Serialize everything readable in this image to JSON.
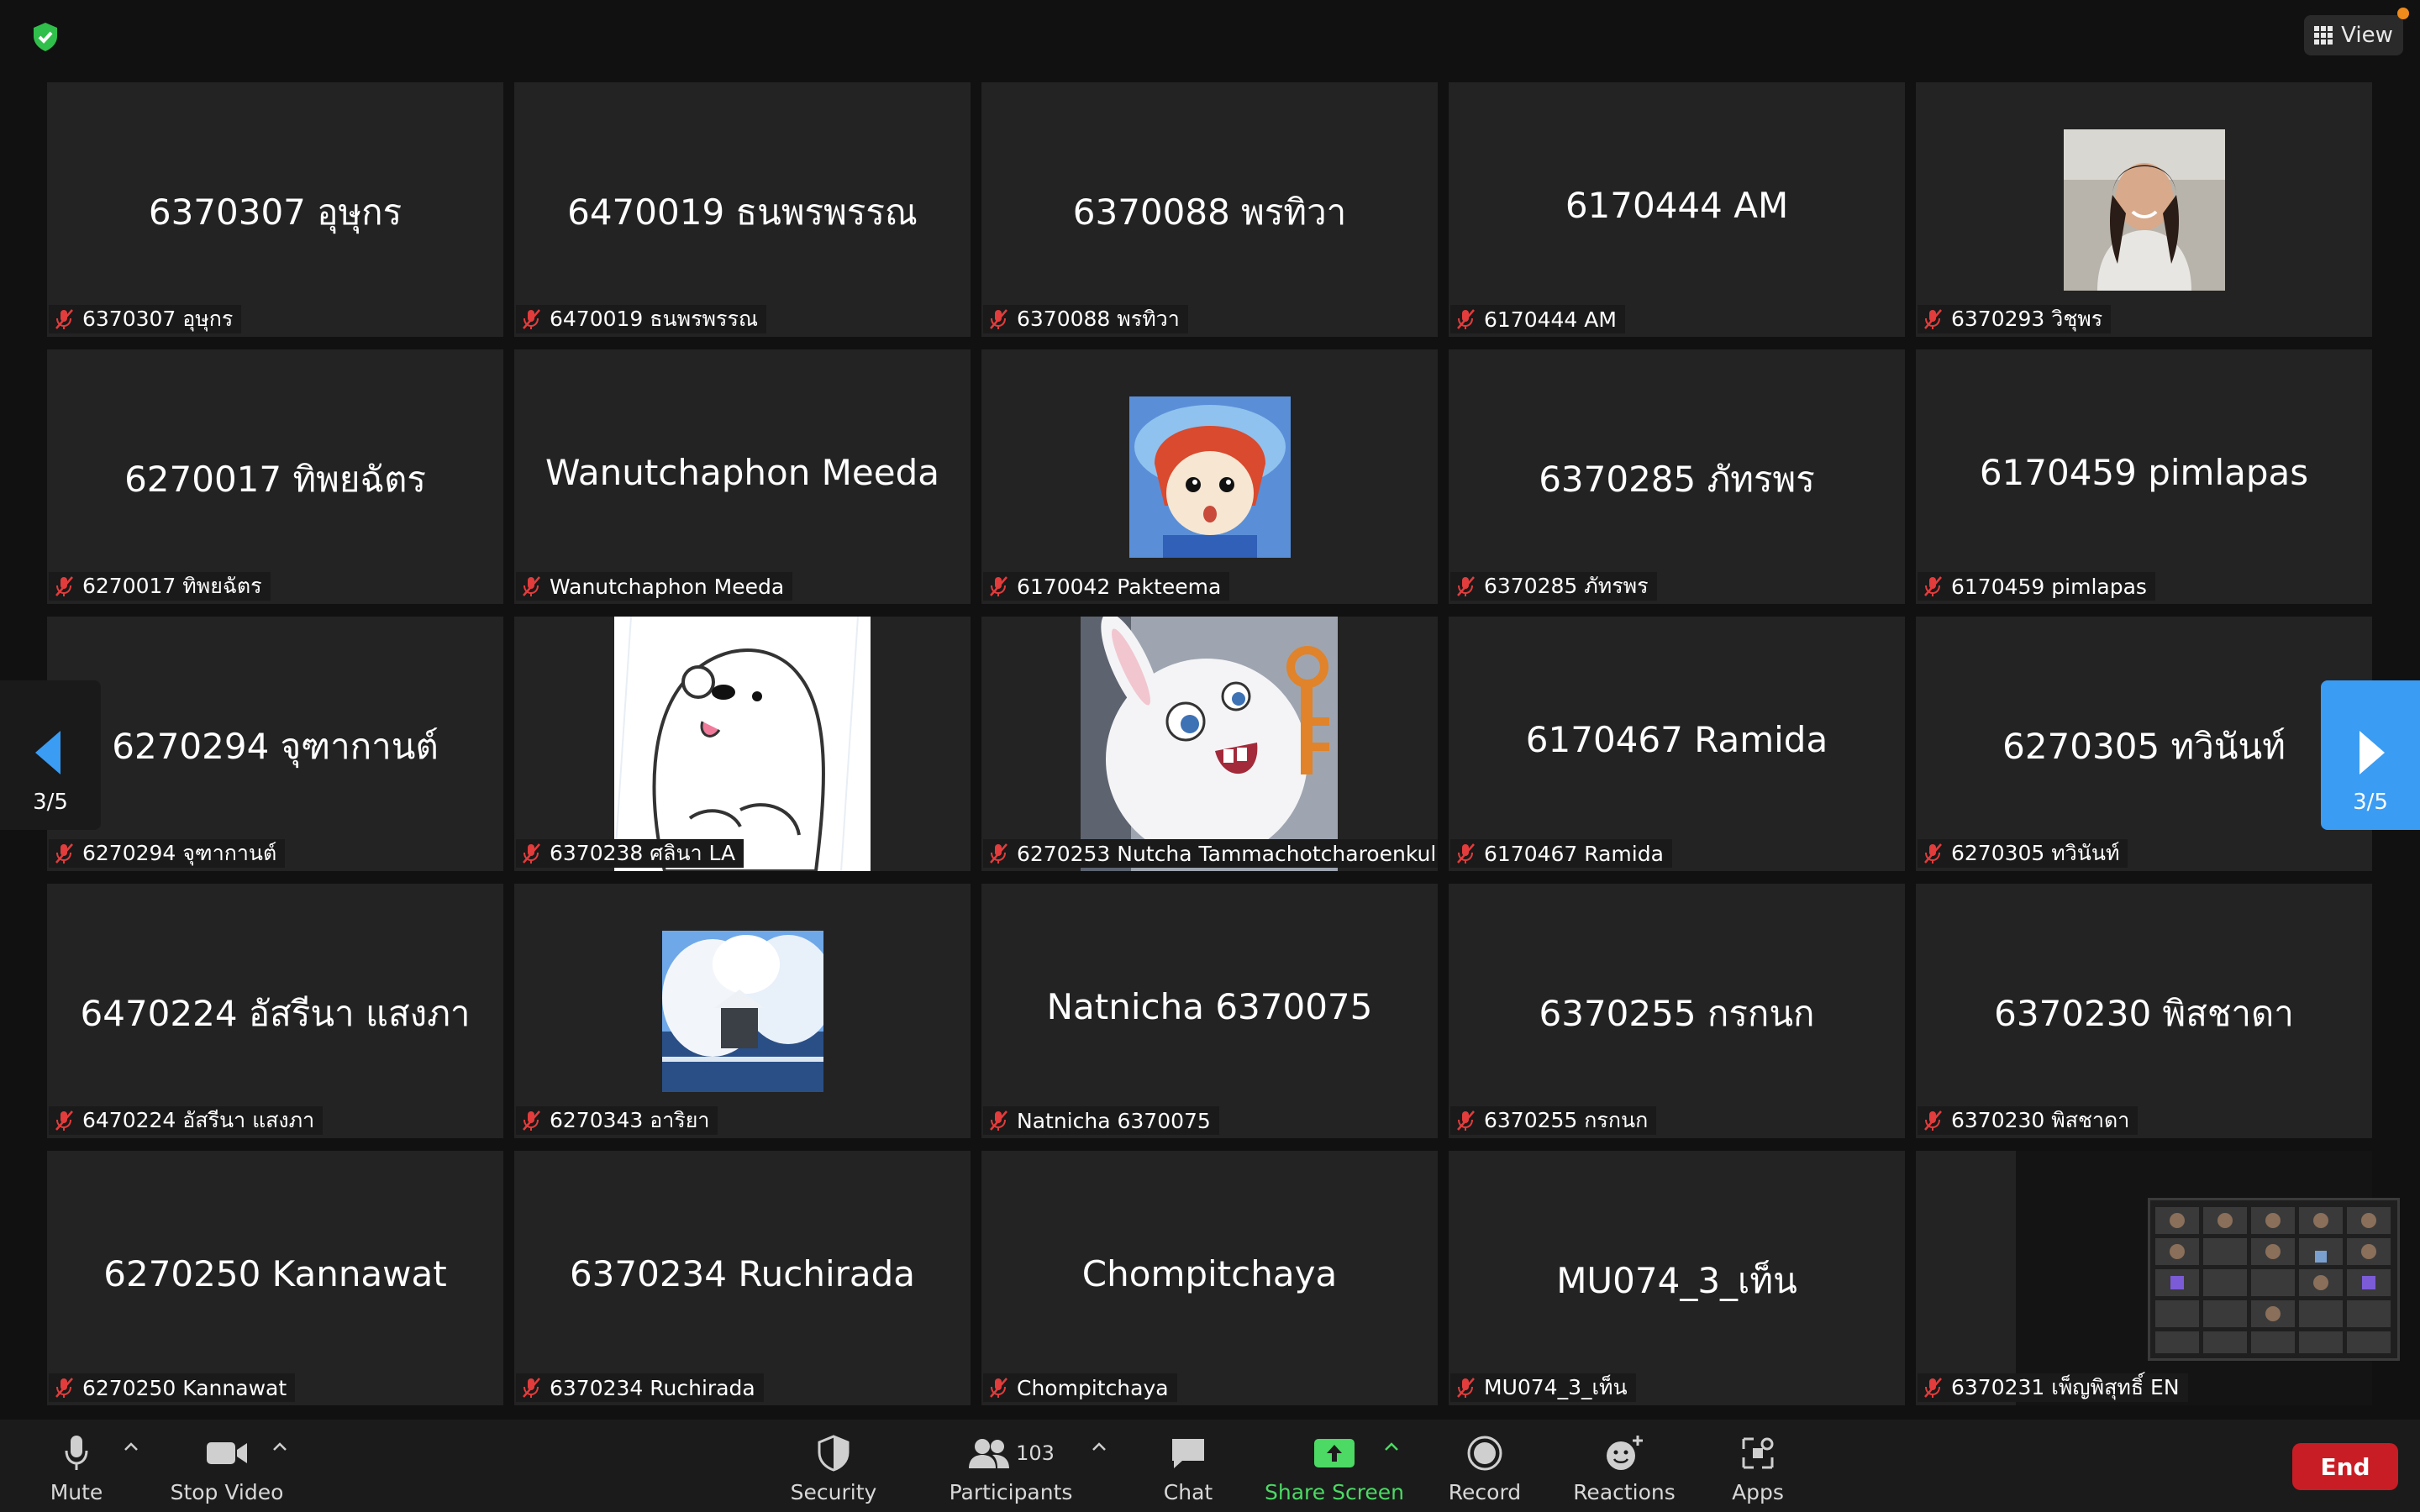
{
  "header": {
    "view_label": "View"
  },
  "tiles": [
    {
      "name": "6370307 อุษุกร",
      "label": "6370307 อุษุกร"
    },
    {
      "name": "6470019 ธนพรพรรณ",
      "label": "6470019 ธนพรพรรณ"
    },
    {
      "name": "6370088 พรทิวา",
      "label": "6370088 พรทิวา"
    },
    {
      "name": "6170444 AM",
      "label": "6170444 AM"
    },
    {
      "name": "",
      "label": "6370293 วิชุพร"
    },
    {
      "name": "6270017 ทิพยฉัตร",
      "label": "6270017 ทิพยฉัตร"
    },
    {
      "name": "Wanutchaphon Meeda",
      "label": "Wanutchaphon Meeda"
    },
    {
      "name": "",
      "label": "6170042 Pakteema"
    },
    {
      "name": "6370285 ภัทรพร",
      "label": "6370285 ภัทรพร"
    },
    {
      "name": "6170459 pimlapas",
      "label": "6170459 pimlapas"
    },
    {
      "name": "6270294 จุฑากานต์",
      "label": "6270294 จุฑากานต์"
    },
    {
      "name": "",
      "label": "6370238 ศลินา LA"
    },
    {
      "name": "",
      "label": "6270253 Nutcha Tammachotcharoenkul"
    },
    {
      "name": "6170467 Ramida",
      "label": "6170467 Ramida"
    },
    {
      "name": "6270305 ทวินันท์",
      "label": "6270305 ทวินันท์"
    },
    {
      "name": "6470224 อัสรีนา แสงภา",
      "label": "6470224 อัสรีนา แสงภา"
    },
    {
      "name": "",
      "label": "6270343 อาริยา"
    },
    {
      "name": "Natnicha 6370075",
      "label": "Natnicha 6370075"
    },
    {
      "name": "6370255 กรกนก",
      "label": "6370255 กรกนก"
    },
    {
      "name": "6370230 พิสชาดา",
      "label": "6370230 พิสชาดา"
    },
    {
      "name": "6270250 Kannawat",
      "label": "6270250 Kannawat"
    },
    {
      "name": "6370234 Ruchirada",
      "label": "6370234 Ruchirada"
    },
    {
      "name": "Chompitchaya",
      "label": "Chompitchaya"
    },
    {
      "name": "MU074_3_เท็น",
      "label": "MU074_3_เท็น"
    },
    {
      "name": "",
      "label": "6370231 เพ็ญพิสุทธิ์ EN"
    }
  ],
  "pagination": {
    "left": "3/5",
    "right": "3/5"
  },
  "toolbar": {
    "mute": "Mute",
    "stop_video": "Stop Video",
    "security": "Security",
    "participants": "Participants",
    "participants_count": "103",
    "chat": "Chat",
    "share_screen": "Share Screen",
    "record": "Record",
    "reactions": "Reactions",
    "apps": "Apps",
    "end": "End"
  },
  "colors": {
    "share_green": "#4cd964",
    "end_red": "#c81d25",
    "page_blue": "#3a9cf3"
  }
}
